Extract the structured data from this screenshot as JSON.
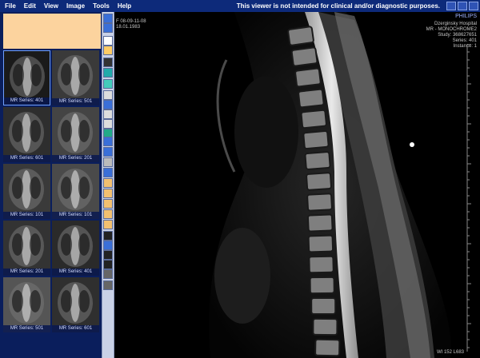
{
  "menu": [
    "File",
    "Edit",
    "View",
    "Image",
    "Tools",
    "Help"
  ],
  "disclaimer": "This viewer is not intended for clinical and/or diagnostic purposes.",
  "brand": "PHILIPS",
  "overlay": {
    "left": [
      "F 08-09-11-08",
      "18.01.1983"
    ],
    "right": [
      "Dzerginsky Hospital",
      "MR - MONOCHROME2",
      "Study: 368627651",
      "Series: 401",
      "Instance: 1"
    ],
    "bottom": "WI 152   L683"
  },
  "thumbnails": [
    {
      "label": "MR Series: 401",
      "selected": true
    },
    {
      "label": "MR Series: 501",
      "selected": false
    },
    {
      "label": "MR Series: 601",
      "selected": false
    },
    {
      "label": "MR Series: 201",
      "selected": false
    },
    {
      "label": "MR Series: 101",
      "selected": false
    },
    {
      "label": "MR Series: 101",
      "selected": false
    },
    {
      "label": "MR Series: 201",
      "selected": false
    },
    {
      "label": "MR Series: 401",
      "selected": false
    },
    {
      "label": "MR Series: 501",
      "selected": false
    },
    {
      "label": "MR Series: 601",
      "selected": false
    }
  ],
  "tools": [
    "copy-icon",
    "zoom-icon",
    "window-level-icon",
    "pan-hand-icon",
    "brightness-icon",
    "contrast-icon",
    "color-icon",
    "pointer-icon",
    "series-stack-icon",
    "list-icon",
    "layout-icon",
    "grid-icon",
    "prev-icon",
    "next-icon",
    "print-icon",
    "export-icon",
    "annotation-icon",
    "annotation2-icon",
    "annotation3-icon",
    "annotation4-icon",
    "annotation5-icon",
    "play-icon",
    "stop-icon",
    "fast-forward-icon",
    "loop-icon",
    "line-measure-icon",
    "angle-measure-icon"
  ]
}
